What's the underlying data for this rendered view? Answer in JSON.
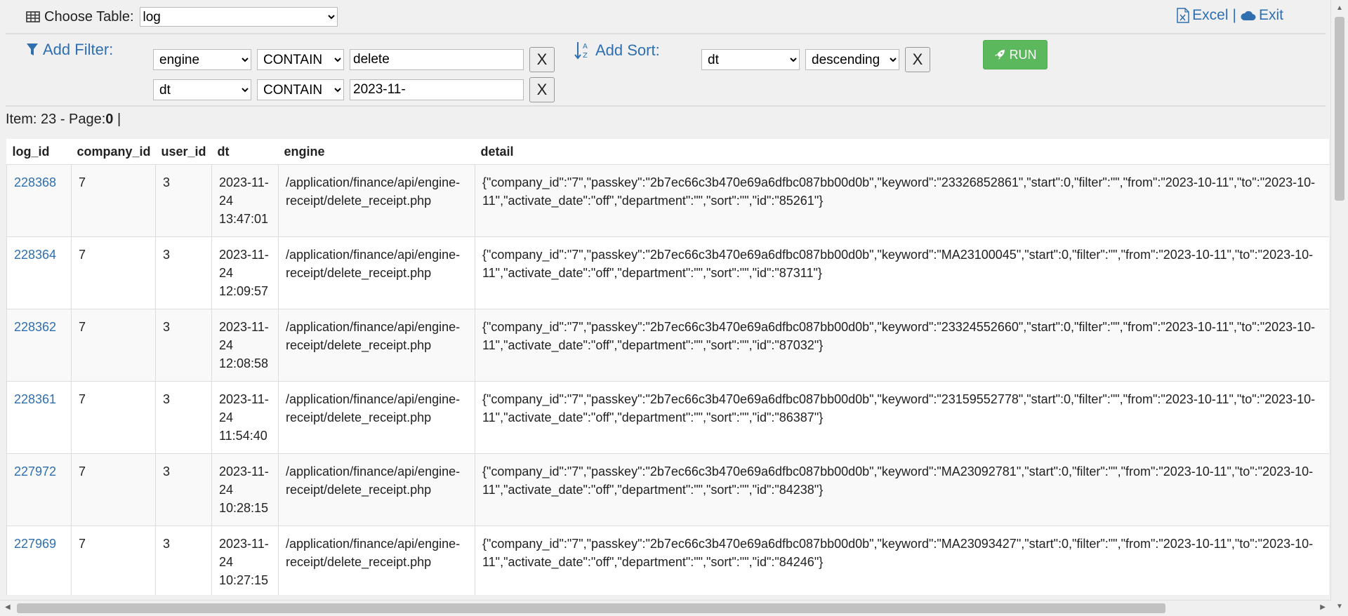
{
  "header": {
    "choose_label": "Choose Table:",
    "table_selected": "log",
    "excel_label": "Excel",
    "separator": "|",
    "exit_label": "Exit"
  },
  "filter": {
    "title": "Add Filter:",
    "rows": [
      {
        "field": "engine",
        "op": "CONTAIN",
        "value": "delete",
        "remove": "X"
      },
      {
        "field": "dt",
        "op": "CONTAIN",
        "value": "2023-11-",
        "remove": "X"
      }
    ]
  },
  "sort": {
    "title": "Add Sort:",
    "field": "dt",
    "direction": "descending",
    "remove": "X"
  },
  "run_label": "RUN",
  "info": {
    "prefix": "Item: 23 - Page:",
    "page": "0",
    "suffix": " |"
  },
  "table": {
    "columns": [
      "log_id",
      "company_id",
      "user_id",
      "dt",
      "engine",
      "detail"
    ],
    "rows": [
      {
        "log_id": "228368",
        "company_id": "7",
        "user_id": "3",
        "dt": "2023-11-24 13:47:01",
        "engine": "/application/finance/api/engine-receipt/delete_receipt.php",
        "detail": "{\"company_id\":\"7\",\"passkey\":\"2b7ec66c3b470e69a6dfbc087bb00d0b\",\"keyword\":\"23326852861\",\"start\":0,\"filter\":\"\",\"from\":\"2023-10-11\",\"to\":\"2023-10-11\",\"activate_date\":\"off\",\"department\":\"\",\"sort\":\"\",\"id\":\"85261\"}"
      },
      {
        "log_id": "228364",
        "company_id": "7",
        "user_id": "3",
        "dt": "2023-11-24 12:09:57",
        "engine": "/application/finance/api/engine-receipt/delete_receipt.php",
        "detail": "{\"company_id\":\"7\",\"passkey\":\"2b7ec66c3b470e69a6dfbc087bb00d0b\",\"keyword\":\"MA23100045\",\"start\":0,\"filter\":\"\",\"from\":\"2023-10-11\",\"to\":\"2023-10-11\",\"activate_date\":\"off\",\"department\":\"\",\"sort\":\"\",\"id\":\"87311\"}"
      },
      {
        "log_id": "228362",
        "company_id": "7",
        "user_id": "3",
        "dt": "2023-11-24 12:08:58",
        "engine": "/application/finance/api/engine-receipt/delete_receipt.php",
        "detail": "{\"company_id\":\"7\",\"passkey\":\"2b7ec66c3b470e69a6dfbc087bb00d0b\",\"keyword\":\"23324552660\",\"start\":0,\"filter\":\"\",\"from\":\"2023-10-11\",\"to\":\"2023-10-11\",\"activate_date\":\"off\",\"department\":\"\",\"sort\":\"\",\"id\":\"87032\"}"
      },
      {
        "log_id": "228361",
        "company_id": "7",
        "user_id": "3",
        "dt": "2023-11-24 11:54:40",
        "engine": "/application/finance/api/engine-receipt/delete_receipt.php",
        "detail": "{\"company_id\":\"7\",\"passkey\":\"2b7ec66c3b470e69a6dfbc087bb00d0b\",\"keyword\":\"23159552778\",\"start\":0,\"filter\":\"\",\"from\":\"2023-10-11\",\"to\":\"2023-10-11\",\"activate_date\":\"off\",\"department\":\"\",\"sort\":\"\",\"id\":\"86387\"}"
      },
      {
        "log_id": "227972",
        "company_id": "7",
        "user_id": "3",
        "dt": "2023-11-24 10:28:15",
        "engine": "/application/finance/api/engine-receipt/delete_receipt.php",
        "detail": "{\"company_id\":\"7\",\"passkey\":\"2b7ec66c3b470e69a6dfbc087bb00d0b\",\"keyword\":\"MA23092781\",\"start\":0,\"filter\":\"\",\"from\":\"2023-10-11\",\"to\":\"2023-10-11\",\"activate_date\":\"off\",\"department\":\"\",\"sort\":\"\",\"id\":\"84238\"}"
      },
      {
        "log_id": "227969",
        "company_id": "7",
        "user_id": "3",
        "dt": "2023-11-24 10:27:15",
        "engine": "/application/finance/api/engine-receipt/delete_receipt.php",
        "detail": "{\"company_id\":\"7\",\"passkey\":\"2b7ec66c3b470e69a6dfbc087bb00d0b\",\"keyword\":\"MA23093427\",\"start\":0,\"filter\":\"\",\"from\":\"2023-10-11\",\"to\":\"2023-10-11\",\"activate_date\":\"off\",\"department\":\"\",\"sort\":\"\",\"id\":\"84246\"}"
      }
    ]
  },
  "colors": {
    "link": "#2f6fb0",
    "run_button": "#5cb85c"
  },
  "icons": [
    "table-icon",
    "excel-icon",
    "cloud-icon",
    "filter-icon",
    "sort-alpha-icon",
    "rocket-icon"
  ]
}
